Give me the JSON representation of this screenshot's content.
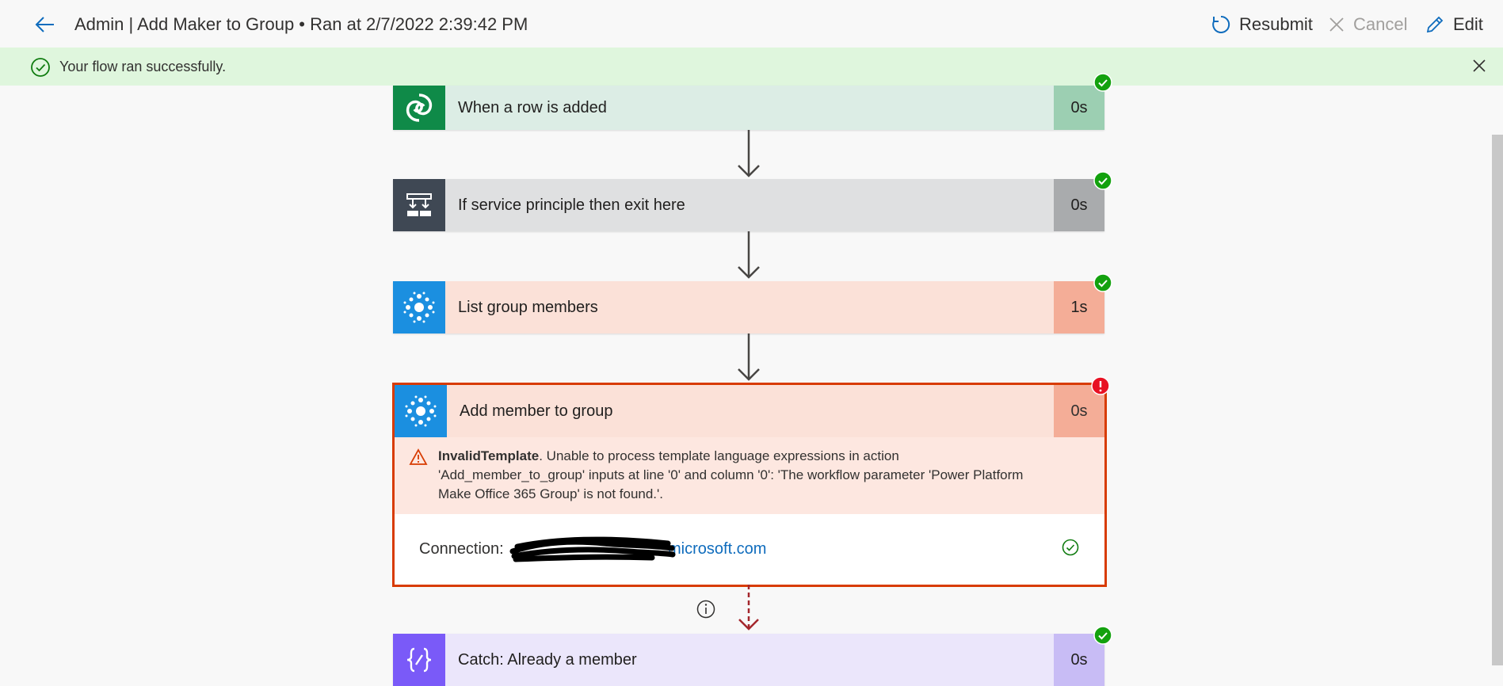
{
  "header": {
    "title": "Admin | Add Maker to Group • Ran at 2/7/2022 2:39:42 PM",
    "resubmit_label": "Resubmit",
    "cancel_label": "Cancel",
    "edit_label": "Edit"
  },
  "banner": {
    "message": "Your flow ran successfully."
  },
  "steps": [
    {
      "name": "When a row is added",
      "duration": "0s",
      "status": "succeeded"
    },
    {
      "name": "If service principle then exit here",
      "duration": "0s",
      "status": "succeeded"
    },
    {
      "name": "List group members",
      "duration": "1s",
      "status": "succeeded"
    },
    {
      "name": "Add member to group",
      "duration": "0s",
      "status": "failed",
      "error_title": "InvalidTemplate",
      "error_message": ". Unable to process template language expressions in action 'Add_member_to_group' inputs at line '0' and column '0': 'The workflow parameter 'Power Platform Make Office 365 Group' is not found.'.",
      "connection_label": "Connection:",
      "connection_value": "microsoft.com"
    },
    {
      "name": "Catch: Already a member",
      "duration": "0s",
      "status": "succeeded"
    }
  ],
  "colors": {
    "success": "#13a10e",
    "error": "#d83b01",
    "banner_bg": "#dff6dd",
    "link": "#0f6cbd"
  }
}
